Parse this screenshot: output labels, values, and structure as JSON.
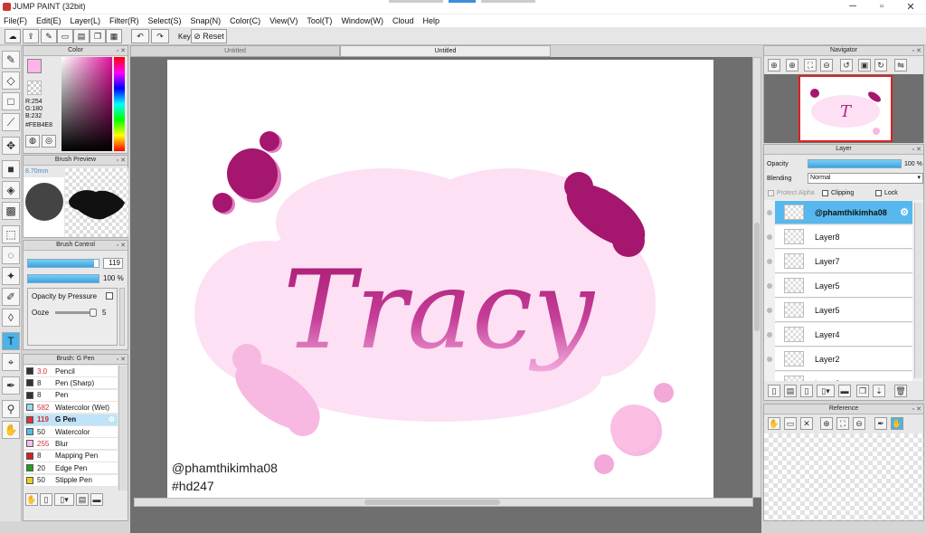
{
  "app": {
    "title": "JUMP PAINT (32bit)"
  },
  "menu": [
    "File(F)",
    "Edit(E)",
    "Layer(L)",
    "Filter(R)",
    "Select(S)",
    "Snap(N)",
    "Color(C)",
    "View(V)",
    "Tool(T)",
    "Window(W)",
    "Cloud",
    "Help"
  ],
  "toolbar": {
    "key_label": "Key",
    "reset_label": "Reset"
  },
  "tabs": {
    "tab1": "Untitled",
    "tab2": "Untitled"
  },
  "color_panel": {
    "title": "Color",
    "r": "R:254",
    "g": "G:180",
    "b": "B:232",
    "hex": "#FEB4E8",
    "main_color": "#feb4e8"
  },
  "brush_preview": {
    "title": "Brush Preview",
    "size": "8.70mm"
  },
  "brush_control": {
    "title": "Brush Control",
    "size_value": "119",
    "size_fill": 0.93,
    "opacity_value": "100 %",
    "opacity_fill": 1.0,
    "opacity_by_pressure": "Opacity by Pressure",
    "ooze_label": "Ooze",
    "ooze_value": "5"
  },
  "brush_list": {
    "title": "Brush: G Pen",
    "items": [
      {
        "size": "3.0",
        "name": "Pencil",
        "color": "#333333",
        "red": true
      },
      {
        "size": "8",
        "name": "Pen (Sharp)",
        "color": "#333333",
        "red": false
      },
      {
        "size": "8",
        "name": "Pen",
        "color": "#333333",
        "red": false
      },
      {
        "size": "582",
        "name": "Watercolor (Wet)",
        "color": "#9ad8f0",
        "red": true
      },
      {
        "size": "119",
        "name": "G Pen",
        "color": "#e83030",
        "red": true,
        "selected": true
      },
      {
        "size": "50",
        "name": "Watercolor",
        "color": "#5ab8e8",
        "red": false
      },
      {
        "size": "255",
        "name": "Blur",
        "color": "#f3c0e8",
        "red": true
      },
      {
        "size": "8",
        "name": "Mapping Pen",
        "color": "#d02020",
        "red": false
      },
      {
        "size": "20",
        "name": "Edge Pen",
        "color": "#20a020",
        "red": false
      },
      {
        "size": "50",
        "name": "Stipple Pen",
        "color": "#e8d020",
        "red": false
      }
    ]
  },
  "navigator": {
    "title": "Navigator"
  },
  "layer_panel": {
    "title": "Layer",
    "opacity_label": "Opacity",
    "opacity_value": "100 %",
    "blending_label": "Blending",
    "blending_value": "Normal",
    "protect_alpha": "Protect Alpha",
    "clipping": "Clipping",
    "lock": "Lock",
    "layers": [
      "@phamthikimha08",
      "Layer8",
      "Layer7",
      "Layer5",
      "Layer5",
      "Layer4",
      "Layer2",
      "Layer2"
    ]
  },
  "reference": {
    "title": "Reference"
  },
  "canvas": {
    "main_text": "Tracy",
    "watermark_line1": "@phamthikimha08",
    "watermark_line2": "#hd247",
    "bg_pink": "#fde0f3",
    "magenta": "#a5166e",
    "light_pink": "#f7b8e2"
  }
}
